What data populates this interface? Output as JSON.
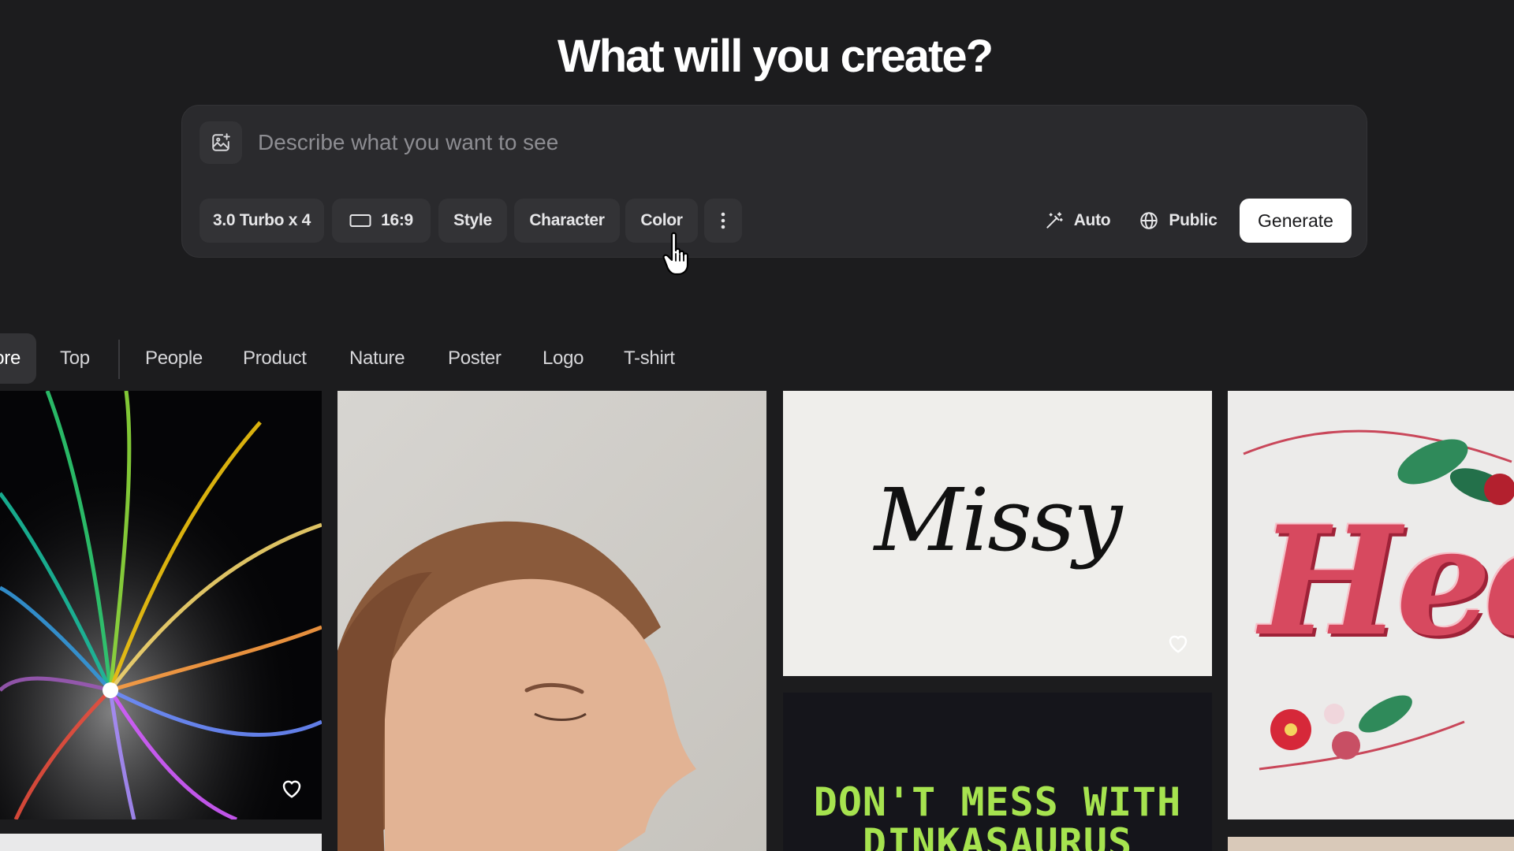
{
  "header": {
    "title": "What will you create?"
  },
  "prompt": {
    "placeholder": "Describe what you want to see",
    "model": "3.0 Turbo x 4",
    "aspect_ratio": "16:9",
    "style": "Style",
    "character": "Character",
    "color": "Color",
    "magic": "Auto",
    "visibility": "Public",
    "generate": "Generate"
  },
  "tabs": [
    {
      "label": "ore",
      "active": true
    },
    {
      "label": "Top"
    },
    {
      "label": "People"
    },
    {
      "label": "Product"
    },
    {
      "label": "Nature"
    },
    {
      "label": "Poster"
    },
    {
      "label": "Logo"
    },
    {
      "label": "T-shirt"
    }
  ],
  "gallery": {
    "logo_text": "Missy",
    "poster_line1": "DON'T MESS WITH",
    "poster_line2": "DINKASAURUS",
    "emboss_text": "Hed"
  },
  "colors": {
    "background": "#1c1c1e",
    "panel": "#2a2a2d",
    "chip": "#333336",
    "generate_bg": "#ffffff",
    "poster_green": "#a6e34f"
  },
  "icons": [
    "image-upload-icon",
    "aspect-ratio-icon",
    "more-vertical-icon",
    "magic-wand-icon",
    "globe-icon",
    "heart-icon",
    "hand-cursor-icon"
  ]
}
